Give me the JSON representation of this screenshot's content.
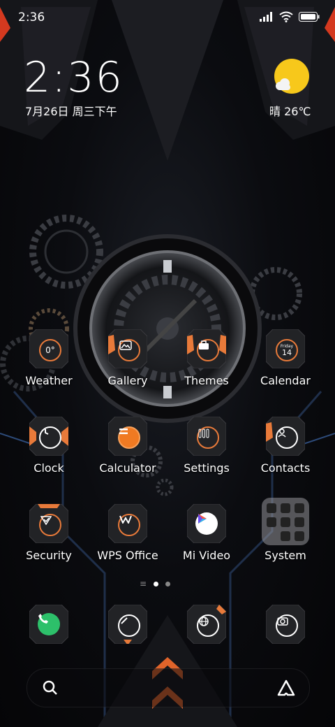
{
  "status_bar": {
    "time": "2:36"
  },
  "clock_widget": {
    "time": "2:36",
    "date": "7月26日 周三下午"
  },
  "weather_widget": {
    "text": "晴 26℃",
    "sun_color": "#f7c81b"
  },
  "apps": [
    {
      "label": "Weather",
      "icon": "weather-icon"
    },
    {
      "label": "Gallery",
      "icon": "gallery-icon"
    },
    {
      "label": "Themes",
      "icon": "themes-icon"
    },
    {
      "label": "Calendar",
      "icon": "calendar-icon",
      "cal_day_name": "Friday",
      "cal_day_num": "14"
    },
    {
      "label": "Clock",
      "icon": "clock-icon"
    },
    {
      "label": "Calculator",
      "icon": "calculator-icon"
    },
    {
      "label": "Settings",
      "icon": "settings-icon"
    },
    {
      "label": "Contacts",
      "icon": "contacts-icon"
    },
    {
      "label": "Security",
      "icon": "security-icon"
    },
    {
      "label": "WPS Office",
      "icon": "wps-office-icon"
    },
    {
      "label": "Mi Video",
      "icon": "mi-video-icon"
    },
    {
      "label": "System",
      "icon": "system-folder-icon"
    }
  ],
  "weather_tile_text": "0°",
  "dock": [
    {
      "name": "phone",
      "icon": "phone-icon"
    },
    {
      "name": "browser",
      "icon": "compass-icon"
    },
    {
      "name": "globe",
      "icon": "globe-icon"
    },
    {
      "name": "camera",
      "icon": "camera-icon"
    }
  ],
  "accent_color": "#e87a3a"
}
